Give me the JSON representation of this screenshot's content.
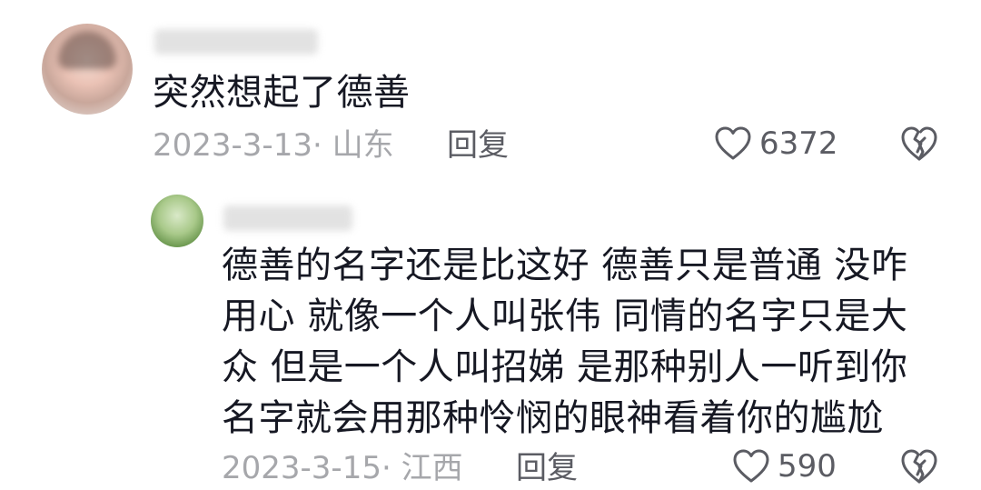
{
  "comment": {
    "text": "突然想起了德善",
    "date_location": "2023-3-13· 山东",
    "reply_label": "回复",
    "like_count": "6372",
    "icons": [
      "heart-icon",
      "broken-heart-icon"
    ]
  },
  "reply": {
    "lines": [
      "德善的名字还是比这好 德善只是普通  没咋",
      "用心 就像一个人叫张伟 同情的名字只是大",
      "众 但是一个人叫招娣 是那种别人一听到你",
      "名字就会用那种怜悯的眼神看着你的尴尬"
    ],
    "date_location": "2023-3-15· 江西",
    "reply_label": "回复",
    "like_count": "590"
  },
  "colors": {
    "text": "#161823",
    "meta": "#a6a7ab",
    "action": "#5b5c63"
  }
}
